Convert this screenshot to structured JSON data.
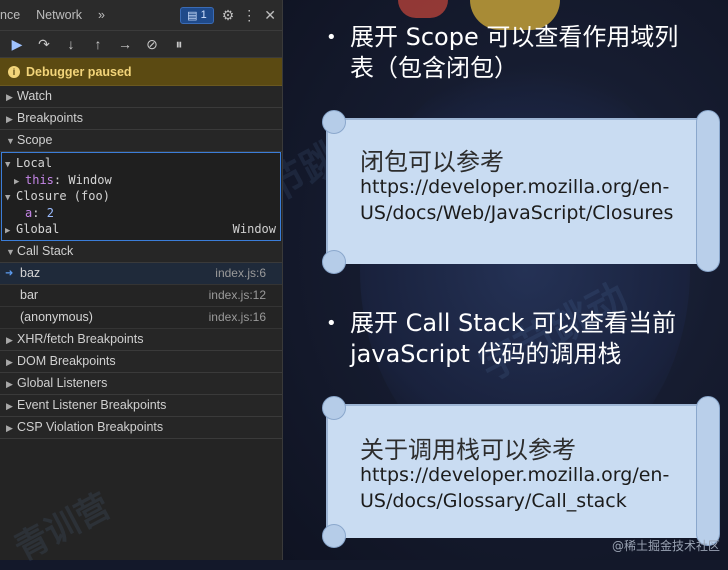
{
  "devtools": {
    "tabs": [
      "nce",
      "Network",
      "»"
    ],
    "badge_count": "1",
    "paused_label": "Debugger paused",
    "sections": {
      "watch": "Watch",
      "breakpoints": "Breakpoints",
      "scope": "Scope",
      "call_stack": "Call Stack",
      "xhr": "XHR/fetch Breakpoints",
      "dom": "DOM Breakpoints",
      "global_listeners": "Global Listeners",
      "event_listener": "Event Listener Breakpoints",
      "csp": "CSP Violation Breakpoints"
    },
    "scope": {
      "local_label": "Local",
      "this_key": "this",
      "this_val": "Window",
      "closure_label": "Closure (foo)",
      "a_key": "a",
      "a_val": "2",
      "global_label": "Global",
      "global_val": "Window"
    },
    "frames": [
      {
        "name": "baz",
        "loc": "index.js:6"
      },
      {
        "name": "bar",
        "loc": "index.js:12"
      },
      {
        "name": "(anonymous)",
        "loc": "index.js:16"
      }
    ]
  },
  "slide": {
    "bullet1_line1": "展开 Scope 可以查看作用域列",
    "bullet1_line2": "表（包含闭包）",
    "card1_title": "闭包可以参考",
    "card1_url_line1": "https://developer.mozilla.org/en-",
    "card1_url_line2": "US/docs/Web/JavaScript/Closures",
    "bullet2_line1": "展开 Call Stack 可以查看当前",
    "bullet2_line2": "javaScript 代码的调用栈",
    "card2_title": "关于调用栈可以参考",
    "card2_url_line1": "https://developer.mozilla.org/en-",
    "card2_url_line2": "US/docs/Glossary/Call_stack",
    "watermark": "字节跳动",
    "watermark2": "青训营",
    "credit": "@稀土掘金技术社区"
  }
}
